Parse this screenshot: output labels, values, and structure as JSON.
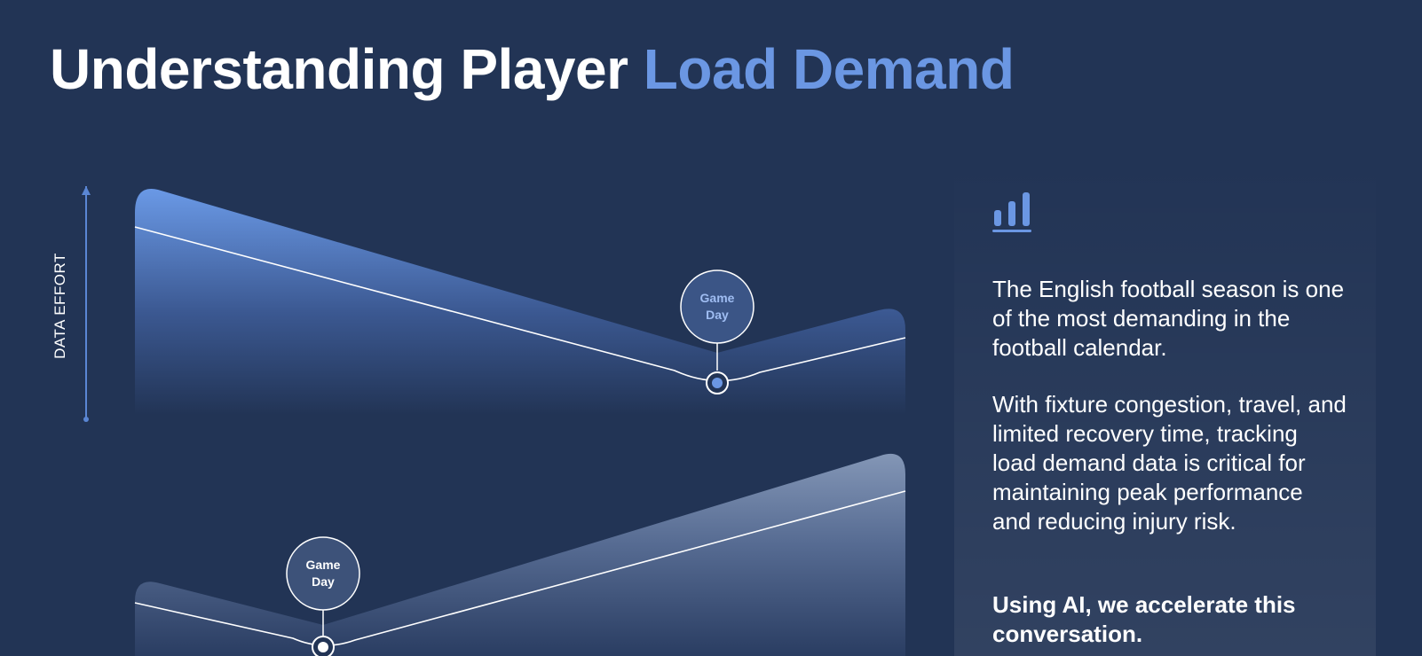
{
  "header": {
    "title_main": "Understanding Player ",
    "title_accent": "Load Demand"
  },
  "axis": {
    "y_label": "DATA EFFORT"
  },
  "chart_top": {
    "marker_label_line1": "Game",
    "marker_label_line2": "Day"
  },
  "chart_bottom": {
    "marker_label_line1": "Game",
    "marker_label_line2": "Day"
  },
  "side_panel": {
    "icon": "bar-chart-icon",
    "paragraph_1": "The English football season is one of the most demanding in the football calendar.",
    "paragraph_2": "With fixture congestion, travel, and limited recovery time, tracking load demand data is critical for maintaining peak performance and reducing injury risk.",
    "paragraph_3": "Using AI, we accelerate this conversation."
  },
  "colors": {
    "background": "#223455",
    "accent": "#6b97e3",
    "text": "#ffffff"
  }
}
